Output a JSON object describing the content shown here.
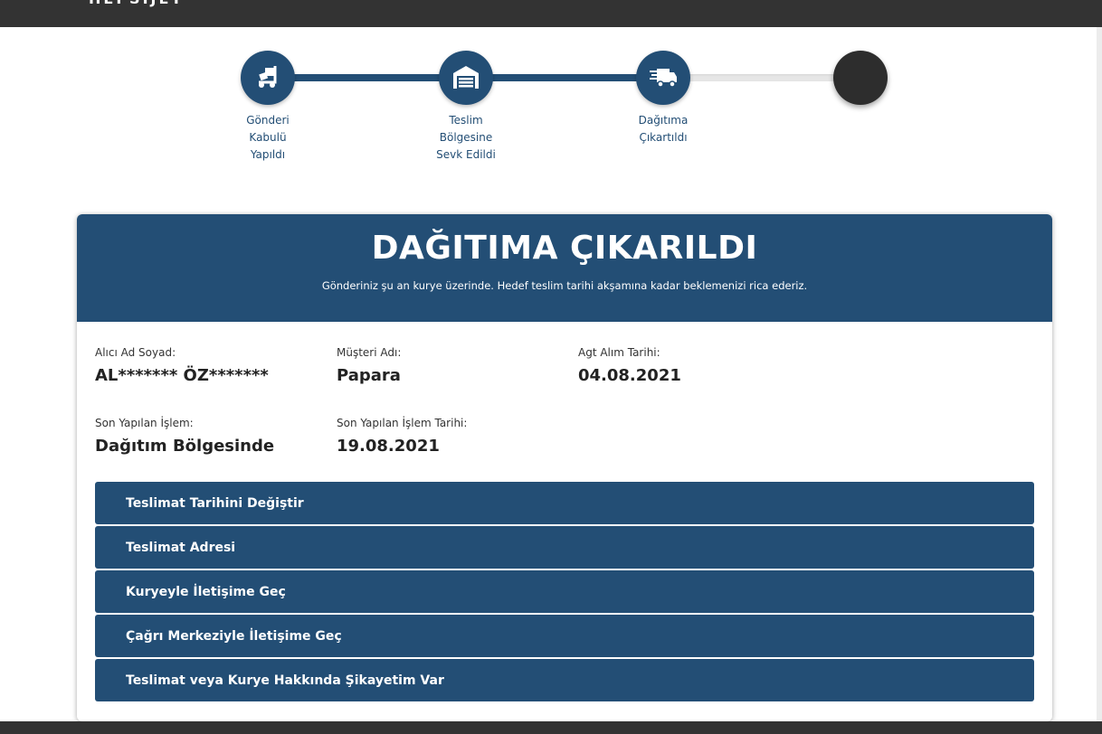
{
  "topbar": {
    "brand": "HEPSIJET"
  },
  "steps": [
    {
      "label": "Gönderi\nKabulü\nYapıldı",
      "icon": "package-hand-truck-icon",
      "state": "done"
    },
    {
      "label": "Teslim\nBölgesine\nSevk Edildi",
      "icon": "warehouse-icon",
      "state": "done"
    },
    {
      "label": "Dağıtıma\nÇıkartıldı",
      "icon": "delivery-truck-icon",
      "state": "done"
    },
    {
      "label": "",
      "icon": "",
      "state": "pending"
    }
  ],
  "card": {
    "title": "DAĞITIMA ÇIKARILDI",
    "subtitle": "Gönderiniz şu an kurye üzerinde. Hedef teslim tarihi akşamına kadar beklemenizi rica ederiz.",
    "fields": {
      "recipient": {
        "label": "Alıcı Ad Soyad:",
        "value": "AL******* ÖZ*******"
      },
      "customer": {
        "label": "Müşteri Adı:",
        "value": "Papara"
      },
      "pickup_date": {
        "label": "Agt Alım Tarihi:",
        "value": "04.08.2021"
      },
      "last_action": {
        "label": "Son Yapılan İşlem:",
        "value": "Dağıtım Bölgesinde"
      },
      "last_action_date": {
        "label": "Son Yapılan İşlem Tarihi:",
        "value": "19.08.2021"
      }
    },
    "actions": [
      "Teslimat Tarihini Değiştir",
      "Teslimat Adresi",
      "Kuryeyle İletişime Geç",
      "Çağrı Merkeziyle İletişime Geç",
      "Teslimat veya Kurye Hakkında Şikayetim Var"
    ]
  },
  "colors": {
    "primary": "#234e75",
    "dark": "#333333",
    "pending": "#e6e6e6"
  }
}
